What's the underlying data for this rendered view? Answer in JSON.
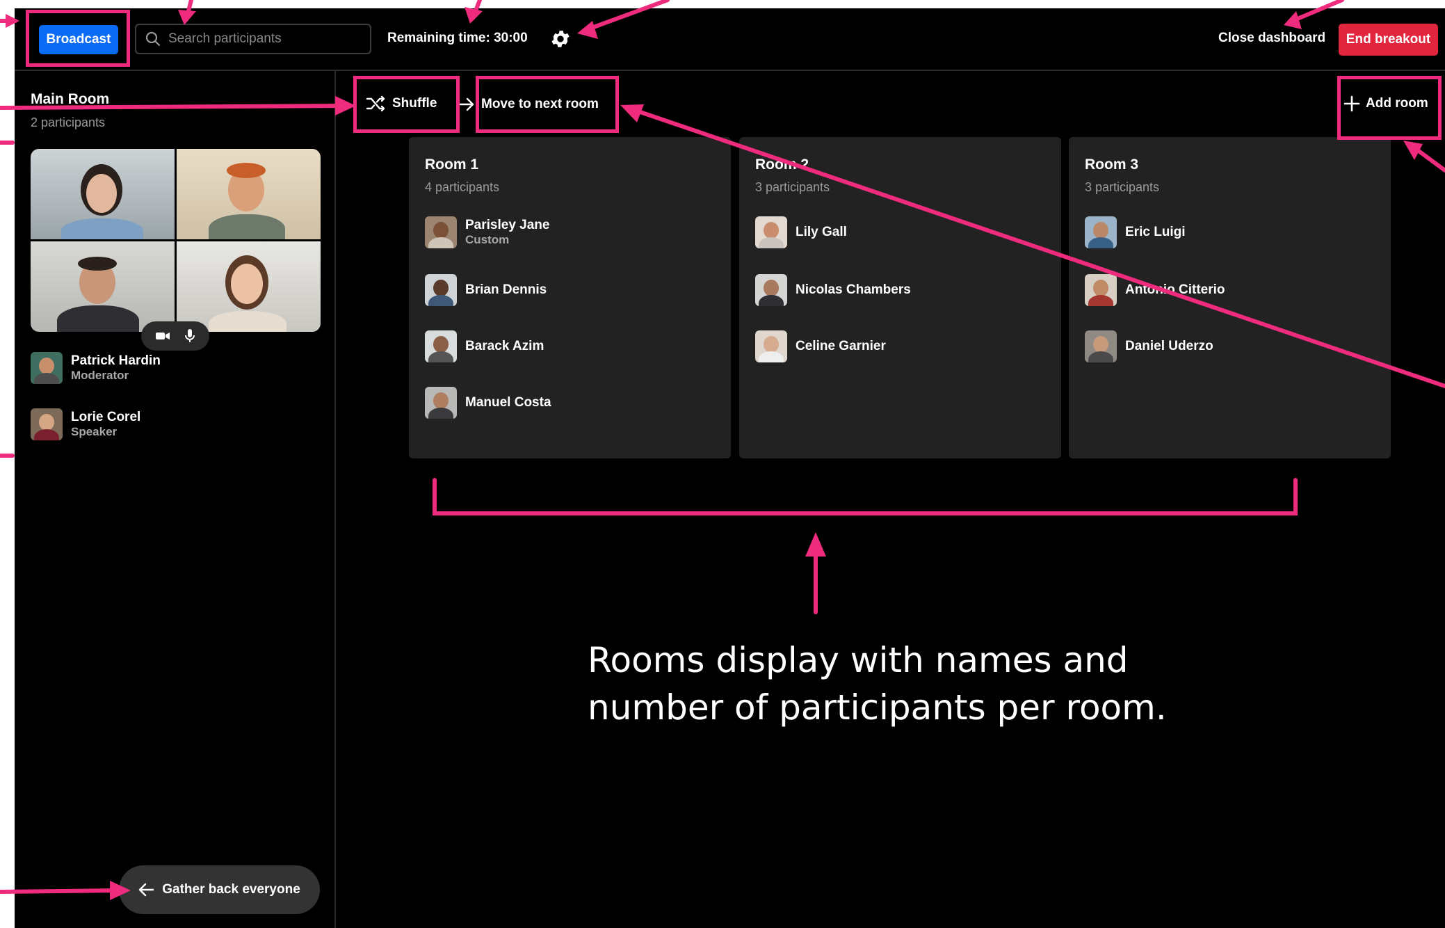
{
  "header": {
    "broadcast_label": "Broadcast",
    "search_placeholder": "Search participants",
    "remaining_time": "Remaining time: 30:00",
    "close_dashboard_label": "Close dashboard",
    "end_breakout_label": "End breakout"
  },
  "main_room": {
    "title": "Main Room",
    "count": "2 participants",
    "participants": [
      {
        "name": "Patrick Hardin",
        "role": "Moderator"
      },
      {
        "name": "Lorie Corel",
        "role": "Speaker"
      }
    ],
    "gather_label": "Gather back everyone"
  },
  "toolbar": {
    "shuffle_label": "Shuffle",
    "move_label": "Move to next room",
    "add_room_label": "Add room"
  },
  "rooms": [
    {
      "title": "Room 1",
      "count": "4 participants",
      "participants": [
        {
          "name": "Parisley Jane",
          "role": "Custom"
        },
        {
          "name": "Brian Dennis"
        },
        {
          "name": "Barack Azim"
        },
        {
          "name": "Manuel Costa"
        }
      ]
    },
    {
      "title": "Room 2",
      "count": "3 participants",
      "participants": [
        {
          "name": "Lily Gall"
        },
        {
          "name": "Nicolas Chambers"
        },
        {
          "name": "Celine Garnier"
        }
      ]
    },
    {
      "title": "Room 3",
      "count": "3 participants",
      "participants": [
        {
          "name": "Eric Luigi"
        },
        {
          "name": "Antonio Citterio"
        },
        {
          "name": "Daniel Uderzo"
        }
      ]
    }
  ],
  "annotation": {
    "caption_line1": "Rooms display with names and",
    "caption_line2": "number of participants per room."
  },
  "colors": {
    "accent": "#0a6cf5",
    "danger": "#e1253d",
    "annotation": "#ee2b7c",
    "panel": "#222222"
  },
  "icons": [
    "search-icon",
    "gear-icon",
    "shuffle-icon",
    "arrow-right-icon",
    "plus-icon",
    "camera-icon",
    "microphone-icon",
    "arrow-left-icon"
  ]
}
